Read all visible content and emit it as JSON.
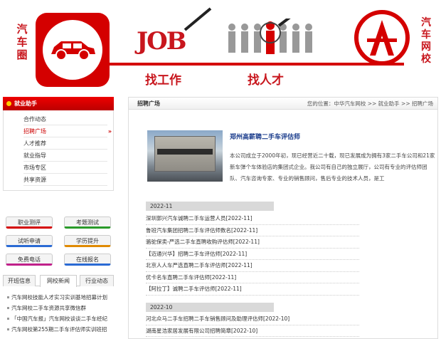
{
  "banner": {
    "left_text": "汽车圈",
    "job_text": "JOB",
    "find_job": "找工作",
    "find_talent": "找人才",
    "right_text": "汽车网校",
    "brand_color": "#d40000"
  },
  "sidebar": {
    "title": "就业助手",
    "items": [
      {
        "label": "合作动态"
      },
      {
        "label": "招聘广场",
        "active": true,
        "arrow": "»"
      },
      {
        "label": "人才推荐"
      },
      {
        "label": "就业指导"
      },
      {
        "label": "市场专区"
      },
      {
        "label": "共享资源"
      }
    ]
  },
  "buttons": [
    "职业测评",
    "考题测试",
    "试听申请",
    "学历提升",
    "免费电话",
    "在线报名"
  ],
  "tabs": [
    "开班信息",
    "网校新闻",
    "行业动态"
  ],
  "news": [
    "汽车网校技能人才实习实训基地招募计划",
    "汽车网校二手车资源共享微信群",
    "「中国汽车报」汽车网校谈谈二手车经纪",
    "汽车网校第255期二手车评估师实训班招"
  ],
  "main": {
    "title": "招聘广场",
    "breadcrumb": "您的位置：中华汽车网校 >> 就业助手 >> 招聘广场",
    "company_title": "郑州高薪聘二手车评估师",
    "company_desc": "本公司成立于2000年初，现已经营近二十载，现已发展成为拥有3家二手车公司和21家新车弹个车体验店的集团式企业。我公司有自己的独立展厅，公司有专业的评估师团队、汽车咨询专家、专业的销售顾问，售后专业的技术人员，是工",
    "groups": [
      {
        "label": "2022-11",
        "jobs": [
          "深圳郭兴汽车诚聘二手车运营人员[2022-11]",
          "鲁班汽车集团招聘二手车评估师数名[2022-11]",
          "骆驼保卖-严选二手车直聘收购评估师[2022-11]",
          "【迈通兴华】招聘二手车评估师[2022-11]",
          "北京人人车严选直聘二手车评估师[2022-11]",
          "优卡名车直聘二手车评估师[2022-11]",
          "【阿拉丁】诚聘二手车评估师[2022-11]"
        ]
      },
      {
        "label": "2022-10",
        "jobs": [
          "河北众马二手车招聘二手车销售顾问及助理评估师[2022-10]",
          "湖南星浩家居发展有限公司招聘简章[2022-10]"
        ]
      }
    ]
  }
}
